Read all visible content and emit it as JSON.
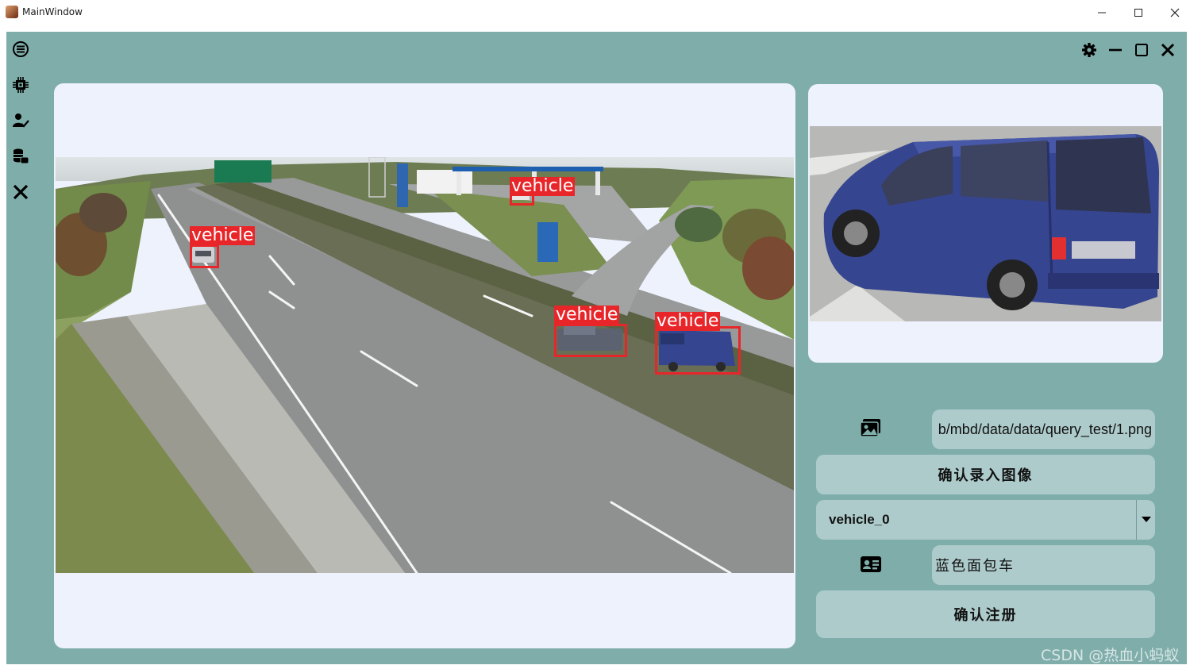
{
  "window": {
    "title": "MainWindow",
    "controls": [
      "minimize",
      "maximize",
      "close"
    ]
  },
  "sidebar": {
    "items": [
      {
        "icon": "menu-icon"
      },
      {
        "icon": "detect-icon"
      },
      {
        "icon": "user-check-icon"
      },
      {
        "icon": "database-icon"
      },
      {
        "icon": "close-icon"
      }
    ]
  },
  "toolbar": {
    "icons": [
      "gear-icon",
      "minimize-icon",
      "maximize-icon",
      "close-icon"
    ]
  },
  "detections": [
    {
      "label": "vehicle"
    },
    {
      "label": "vehicle"
    },
    {
      "label": "vehicle"
    },
    {
      "label": "vehicle"
    }
  ],
  "controls": {
    "image_path": "b/mbd/data/data/query_test/1.png",
    "confirm_image_button": "确认录入图像",
    "vehicle_select": "vehicle_0",
    "vehicle_name": "蓝色面包车",
    "register_button": "确认注册"
  },
  "watermark": "CSDN @热血小蚂蚁",
  "colors": {
    "background": "#7fadaa",
    "panel": "#eef2fd",
    "field": "#aecbcb",
    "box": "#e8262a",
    "van": "#35458f"
  }
}
